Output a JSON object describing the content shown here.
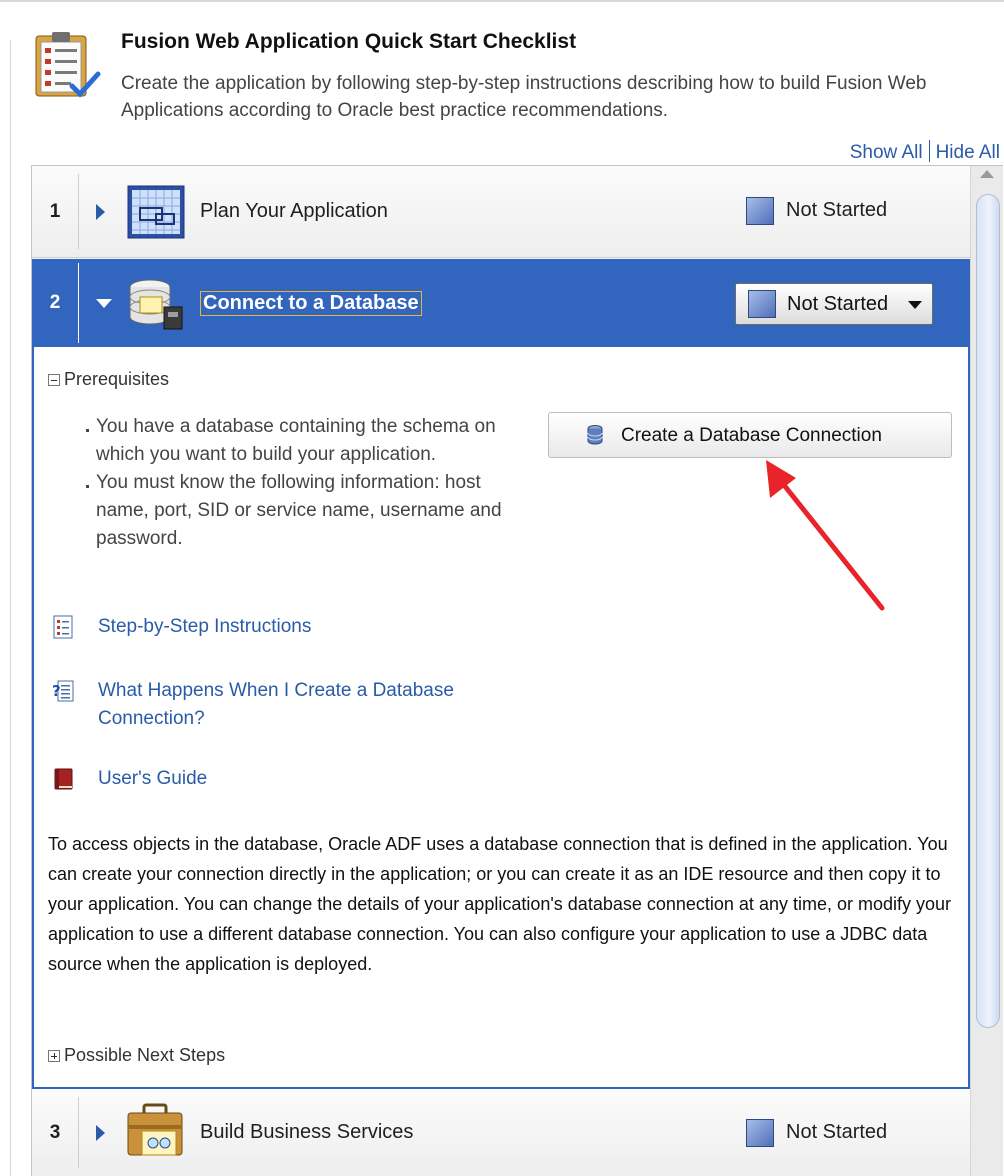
{
  "header": {
    "title": "Fusion Web Application Quick Start Checklist",
    "description": "Create the application by following step-by-step instructions describing how to build Fusion Web Applications according to Oracle best practice recommendations."
  },
  "controls": {
    "show_all": "Show All",
    "hide_all": "Hide All"
  },
  "steps": [
    {
      "number": "1",
      "title": "Plan Your Application",
      "status": "Not Started",
      "icon": "application-plan-icon",
      "expanded": false
    },
    {
      "number": "2",
      "title": "Connect to a Database",
      "status": "Not Started",
      "icon": "database-connection-icon",
      "expanded": true
    },
    {
      "number": "3",
      "title": "Build Business Services",
      "status": "Not Started",
      "icon": "business-services-briefcase-icon",
      "expanded": false
    }
  ],
  "step2": {
    "prerequisites_label": "Prerequisites",
    "prerequisites": [
      "You have a database containing the schema on which you want to build your application.",
      "You must know the following information: host name, port, SID or service name, username and password."
    ],
    "action_button": "Create a Database Connection",
    "links": [
      {
        "label": "Step-by-Step Instructions",
        "icon": "checklist-icon"
      },
      {
        "label": "What Happens When I Create a Database Connection?",
        "icon": "help-topic-icon"
      },
      {
        "label": "User's Guide",
        "icon": "book-icon"
      }
    ],
    "description": "To access objects in the database, Oracle ADF uses a database connection that is defined in the application. You can create your connection directly in the application; or you can create it as an IDE resource and then copy it to your application. You can change the details of your application's database connection at any time, or modify your application to use a different database connection. You can also configure your application to use a JDBC data source when the application is deployed.",
    "next_steps_label": "Possible Next Steps"
  },
  "colors": {
    "selected_row": "#3265bd",
    "link": "#2a5ba8",
    "annotation_arrow": "#e8232a",
    "status_swatch": "#5b7bc4"
  }
}
